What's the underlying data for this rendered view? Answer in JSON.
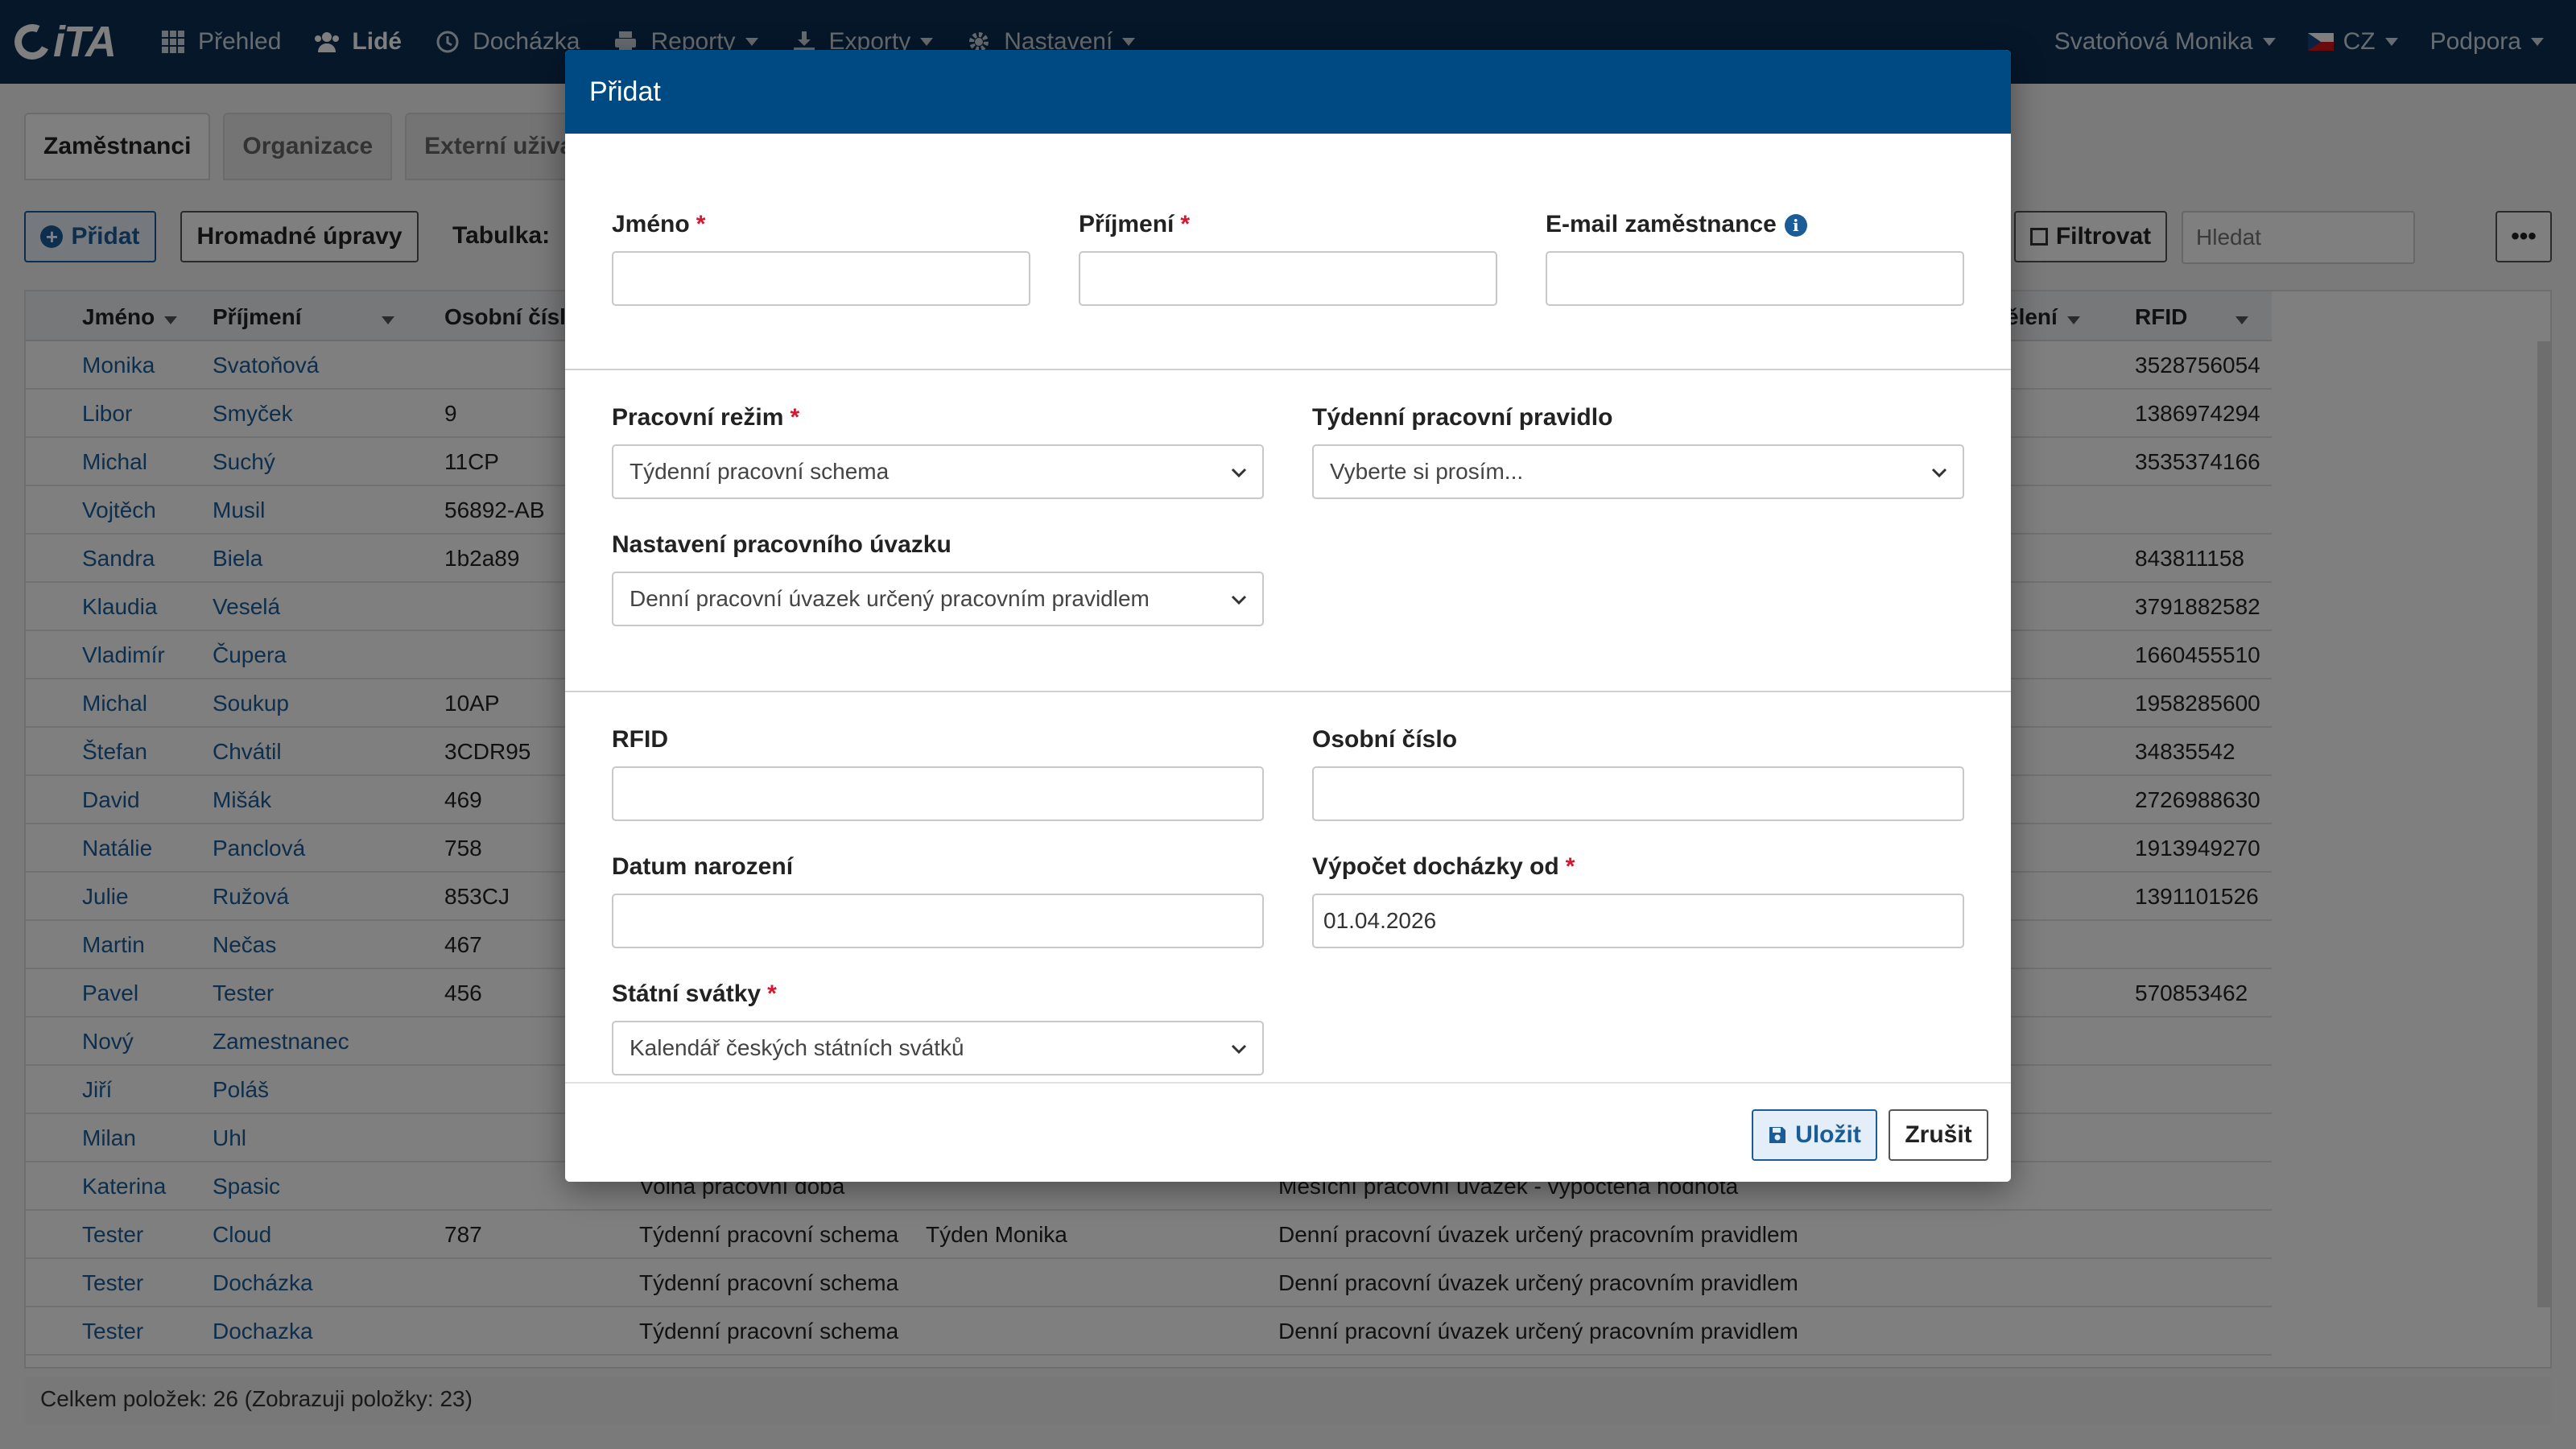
{
  "nav": {
    "logo": "iTA",
    "items": [
      "Přehled",
      "Lidé",
      "Docházka",
      "Reporty",
      "Exporty",
      "Nastavení"
    ],
    "user": "Svatoňová Monika",
    "language": "CZ",
    "support": "Podpora"
  },
  "tabs": [
    "Zaměstnanci",
    "Organizace",
    "Externí uživa"
  ],
  "toolbar": {
    "add_label": "Přidat",
    "bulk_label": "Hromadné úpravy",
    "table_label": "Tabulka:",
    "filter_label": "Filtrovat",
    "search_placeholder": "Hledat",
    "more_label": "•••"
  },
  "table": {
    "headers": [
      "Jméno",
      "Příjmení",
      "Osobní čísl",
      "ělení",
      "RFID"
    ],
    "rows": [
      {
        "first": "Monika",
        "last": "Svatoňová",
        "num": "",
        "regime": "",
        "rule": "",
        "load": "",
        "rfid": "3528756054"
      },
      {
        "first": "Libor",
        "last": "Smyček",
        "num": "9",
        "regime": "",
        "rule": "",
        "load": "",
        "rfid": "1386974294"
      },
      {
        "first": "Michal",
        "last": "Suchý",
        "num": "11CP",
        "regime": "",
        "rule": "",
        "load": "",
        "rfid": "3535374166"
      },
      {
        "first": "Vojtěch",
        "last": "Musil",
        "num": "56892-AB",
        "regime": "",
        "rule": "",
        "load": "",
        "rfid": ""
      },
      {
        "first": "Sandra",
        "last": "Biela",
        "num": "1b2a89",
        "regime": "",
        "rule": "",
        "load": "",
        "rfid": "843811158"
      },
      {
        "first": "Klaudia",
        "last": "Veselá",
        "num": "",
        "regime": "",
        "rule": "",
        "load": "",
        "rfid": "3791882582"
      },
      {
        "first": "Vladimír",
        "last": "Čupera",
        "num": "",
        "regime": "",
        "rule": "",
        "load": "",
        "rfid": "1660455510"
      },
      {
        "first": "Michal",
        "last": "Soukup",
        "num": "10AP",
        "regime": "",
        "rule": "",
        "load": "",
        "rfid": "1958285600"
      },
      {
        "first": "Štefan",
        "last": "Chvátil",
        "num": "3CDR95",
        "regime": "",
        "rule": "",
        "load": "",
        "rfid": "34835542"
      },
      {
        "first": "David",
        "last": "Mišák",
        "num": "469",
        "regime": "",
        "rule": "",
        "load": "",
        "rfid": "2726988630"
      },
      {
        "first": "Natálie",
        "last": "Panclová",
        "num": "758",
        "regime": "",
        "rule": "",
        "load": "",
        "rfid": "1913949270"
      },
      {
        "first": "Julie",
        "last": "Ružová",
        "num": "853CJ",
        "regime": "",
        "rule": "",
        "load": "",
        "rfid": "1391101526"
      },
      {
        "first": "Martin",
        "last": "Nečas",
        "num": "467",
        "regime": "",
        "rule": "",
        "load": "",
        "rfid": ""
      },
      {
        "first": "Pavel",
        "last": "Tester",
        "num": "456",
        "regime": "",
        "rule": "",
        "load": "",
        "rfid": "570853462"
      },
      {
        "first": "Nový",
        "last": "Zamestnanec",
        "num": "",
        "regime": "",
        "rule": "",
        "load": "",
        "rfid": ""
      },
      {
        "first": "Jiří",
        "last": "Poláš",
        "num": "",
        "regime": "",
        "rule": "",
        "load": "",
        "rfid": ""
      },
      {
        "first": "Milan",
        "last": "Uhl",
        "num": "",
        "regime": "",
        "rule": "",
        "load": "",
        "rfid": ""
      },
      {
        "first": "Katerina",
        "last": "Spasic",
        "num": "",
        "regime": "Volná pracovní doba",
        "rule": "",
        "load": "Měsíční pracovní úvazek - vypočtená hodnota",
        "rfid": ""
      },
      {
        "first": "Tester",
        "last": "Cloud",
        "num": "787",
        "regime": "Týdenní pracovní schema",
        "rule": "Týden Monika",
        "load": "Denní pracovní úvazek určený pracovním pravidlem",
        "rfid": ""
      },
      {
        "first": "Tester",
        "last": "Docházka",
        "num": "",
        "regime": "Týdenní pracovní schema",
        "rule": "",
        "load": "Denní pracovní úvazek určený pracovním pravidlem",
        "rfid": ""
      },
      {
        "first": "Tester",
        "last": "Dochazka",
        "num": "",
        "regime": "Týdenní pracovní schema",
        "rule": "",
        "load": "Denní pracovní úvazek určený pracovním pravidlem",
        "rfid": ""
      }
    ],
    "footer": "Celkem položek: 26 (Zobrazuji položky: 23)"
  },
  "modal": {
    "title": "Přidat",
    "first_name_label": "Jméno",
    "last_name_label": "Příjmení",
    "email_label": "E-mail zaměstnance",
    "regime_label": "Pracovní režim",
    "regime_value": "Týdenní pracovní schema",
    "weekly_rule_label": "Týdenní pracovní pravidlo",
    "weekly_rule_value": "Vyberte si prosím...",
    "load_label": "Nastavení pracovního úvazku",
    "load_value": "Denní pracovní úvazek určený pracovním pravidlem",
    "rfid_label": "RFID",
    "personal_number_label": "Osobní číslo",
    "birthdate_label": "Datum narození",
    "attendance_from_label": "Výpočet docházky od",
    "attendance_from_value": "01.04.2026",
    "holidays_label": "Státní svátky",
    "holidays_value": "Kalendář českých státních svátků",
    "required_mark": "*",
    "save_label": "Uložit",
    "cancel_label": "Zrušit"
  },
  "colors": {
    "nav_bg": "#0d2f55",
    "modal_header_bg": "#004a83",
    "link": "#1a5c98",
    "required": "#d4172f"
  }
}
